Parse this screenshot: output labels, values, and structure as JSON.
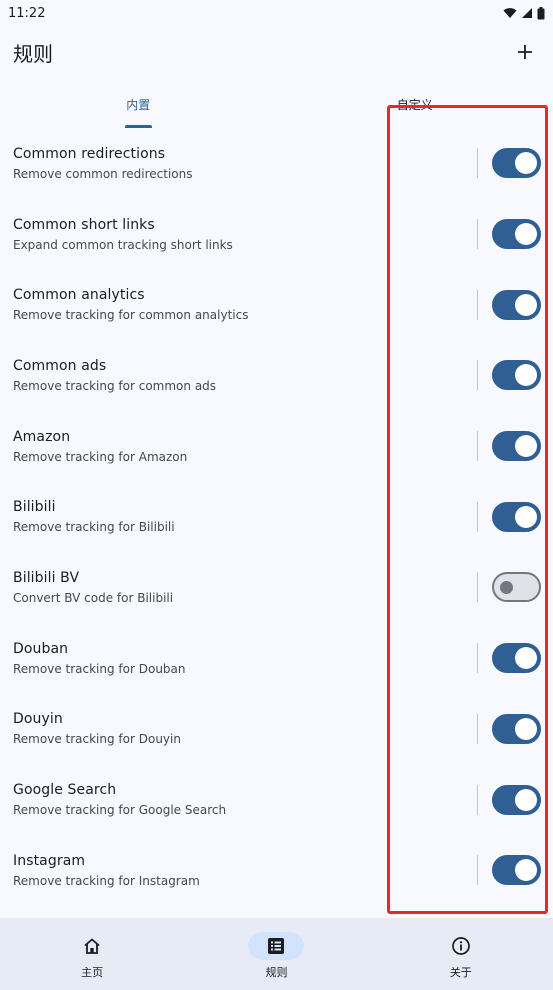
{
  "status": {
    "time": "11:22"
  },
  "app_bar": {
    "title": "规则",
    "add_icon": "plus-icon"
  },
  "tabs": [
    {
      "label": "内置",
      "active": true
    },
    {
      "label": "自定义",
      "active": false
    }
  ],
  "rules": [
    {
      "title": "Common redirections",
      "desc": "Remove common redirections",
      "enabled": true
    },
    {
      "title": "Common short links",
      "desc": "Expand common tracking short links",
      "enabled": true
    },
    {
      "title": "Common analytics",
      "desc": "Remove tracking for common analytics",
      "enabled": true
    },
    {
      "title": "Common ads",
      "desc": "Remove tracking for common ads",
      "enabled": true
    },
    {
      "title": "Amazon",
      "desc": "Remove tracking for Amazon",
      "enabled": true
    },
    {
      "title": "Bilibili",
      "desc": "Remove tracking for Bilibili",
      "enabled": true
    },
    {
      "title": "Bilibili BV",
      "desc": "Convert BV code for Bilibili",
      "enabled": false
    },
    {
      "title": "Douban",
      "desc": "Remove tracking for Douban",
      "enabled": true
    },
    {
      "title": "Douyin",
      "desc": "Remove tracking for Douyin",
      "enabled": true
    },
    {
      "title": "Google Search",
      "desc": "Remove tracking for Google Search",
      "enabled": true
    },
    {
      "title": "Instagram",
      "desc": "Remove tracking for Instagram",
      "enabled": true
    }
  ],
  "bottom_nav": [
    {
      "label": "主页",
      "icon": "home-icon",
      "active": false
    },
    {
      "label": "规则",
      "icon": "list-icon",
      "active": true
    },
    {
      "label": "关于",
      "icon": "info-icon",
      "active": false
    }
  ],
  "colors": {
    "accent": "#2f5f93",
    "highlight": "#e8282b"
  }
}
